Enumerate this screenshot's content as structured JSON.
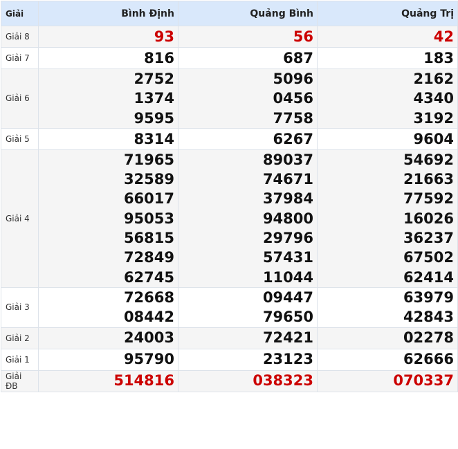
{
  "header": {
    "label": "Giải",
    "provinces": [
      "Bình Định",
      "Quảng Bình",
      "Quảng Trị"
    ]
  },
  "colors": {
    "header_bg": "#d9e8fb",
    "highlight": "#cc0000"
  },
  "rows": [
    {
      "label": "Giải 8",
      "highlight": true,
      "values": [
        [
          "93"
        ],
        [
          "56"
        ],
        [
          "42"
        ]
      ]
    },
    {
      "label": "Giải 7",
      "highlight": false,
      "values": [
        [
          "816"
        ],
        [
          "687"
        ],
        [
          "183"
        ]
      ]
    },
    {
      "label": "Giải 6",
      "highlight": false,
      "values": [
        [
          "2752",
          "1374",
          "9595"
        ],
        [
          "5096",
          "0456",
          "7758"
        ],
        [
          "2162",
          "4340",
          "3192"
        ]
      ]
    },
    {
      "label": "Giải 5",
      "highlight": false,
      "values": [
        [
          "8314"
        ],
        [
          "6267"
        ],
        [
          "9604"
        ]
      ]
    },
    {
      "label": "Giải 4",
      "highlight": false,
      "values": [
        [
          "71965",
          "32589",
          "66017",
          "95053",
          "56815",
          "72849",
          "62745"
        ],
        [
          "89037",
          "74671",
          "37984",
          "94800",
          "29796",
          "57431",
          "11044"
        ],
        [
          "54692",
          "21663",
          "77592",
          "16026",
          "36237",
          "67502",
          "62414"
        ]
      ]
    },
    {
      "label": "Giải 3",
      "highlight": false,
      "values": [
        [
          "72668",
          "08442"
        ],
        [
          "09447",
          "79650"
        ],
        [
          "63979",
          "42843"
        ]
      ]
    },
    {
      "label": "Giải 2",
      "highlight": false,
      "values": [
        [
          "24003"
        ],
        [
          "72421"
        ],
        [
          "02278"
        ]
      ]
    },
    {
      "label": "Giải 1",
      "highlight": false,
      "values": [
        [
          "95790"
        ],
        [
          "23123"
        ],
        [
          "62666"
        ]
      ]
    },
    {
      "label": "Giải ĐB",
      "highlight": true,
      "values": [
        [
          "514816"
        ],
        [
          "038323"
        ],
        [
          "070337"
        ]
      ]
    }
  ]
}
